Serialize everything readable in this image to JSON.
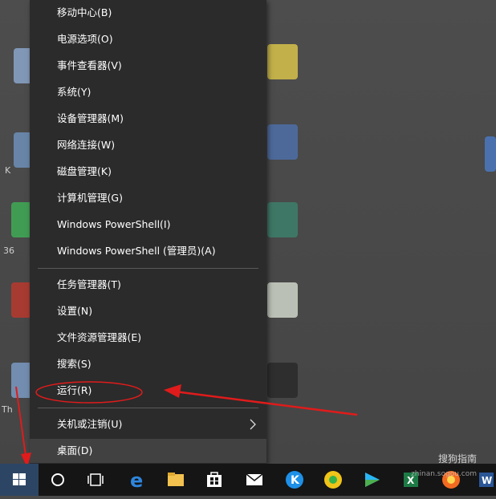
{
  "menu": {
    "items": [
      {
        "label": "移动中心(B)"
      },
      {
        "label": "电源选项(O)"
      },
      {
        "label": "事件查看器(V)"
      },
      {
        "label": "系统(Y)"
      },
      {
        "label": "设备管理器(M)"
      },
      {
        "label": "网络连接(W)"
      },
      {
        "label": "磁盘管理(K)"
      },
      {
        "label": "计算机管理(G)"
      },
      {
        "label": "Windows PowerShell(I)"
      },
      {
        "label": "Windows PowerShell (管理员)(A)"
      },
      {
        "label": "任务管理器(T)"
      },
      {
        "label": "设置(N)"
      },
      {
        "label": "文件资源管理器(E)"
      },
      {
        "label": "搜索(S)"
      },
      {
        "label": "运行(R)"
      },
      {
        "label": "关机或注销(U)"
      },
      {
        "label": "桌面(D)"
      }
    ]
  },
  "desktop": {
    "left_labels": [
      "K",
      "36",
      "Th"
    ]
  },
  "watermark": {
    "text": "搜狗指南",
    "url": "zhinan.sogou.com"
  },
  "colors": {
    "menu_bg": "#2b2b2b",
    "annotation_red": "#e01b1b",
    "start_button": "#2c4564"
  }
}
